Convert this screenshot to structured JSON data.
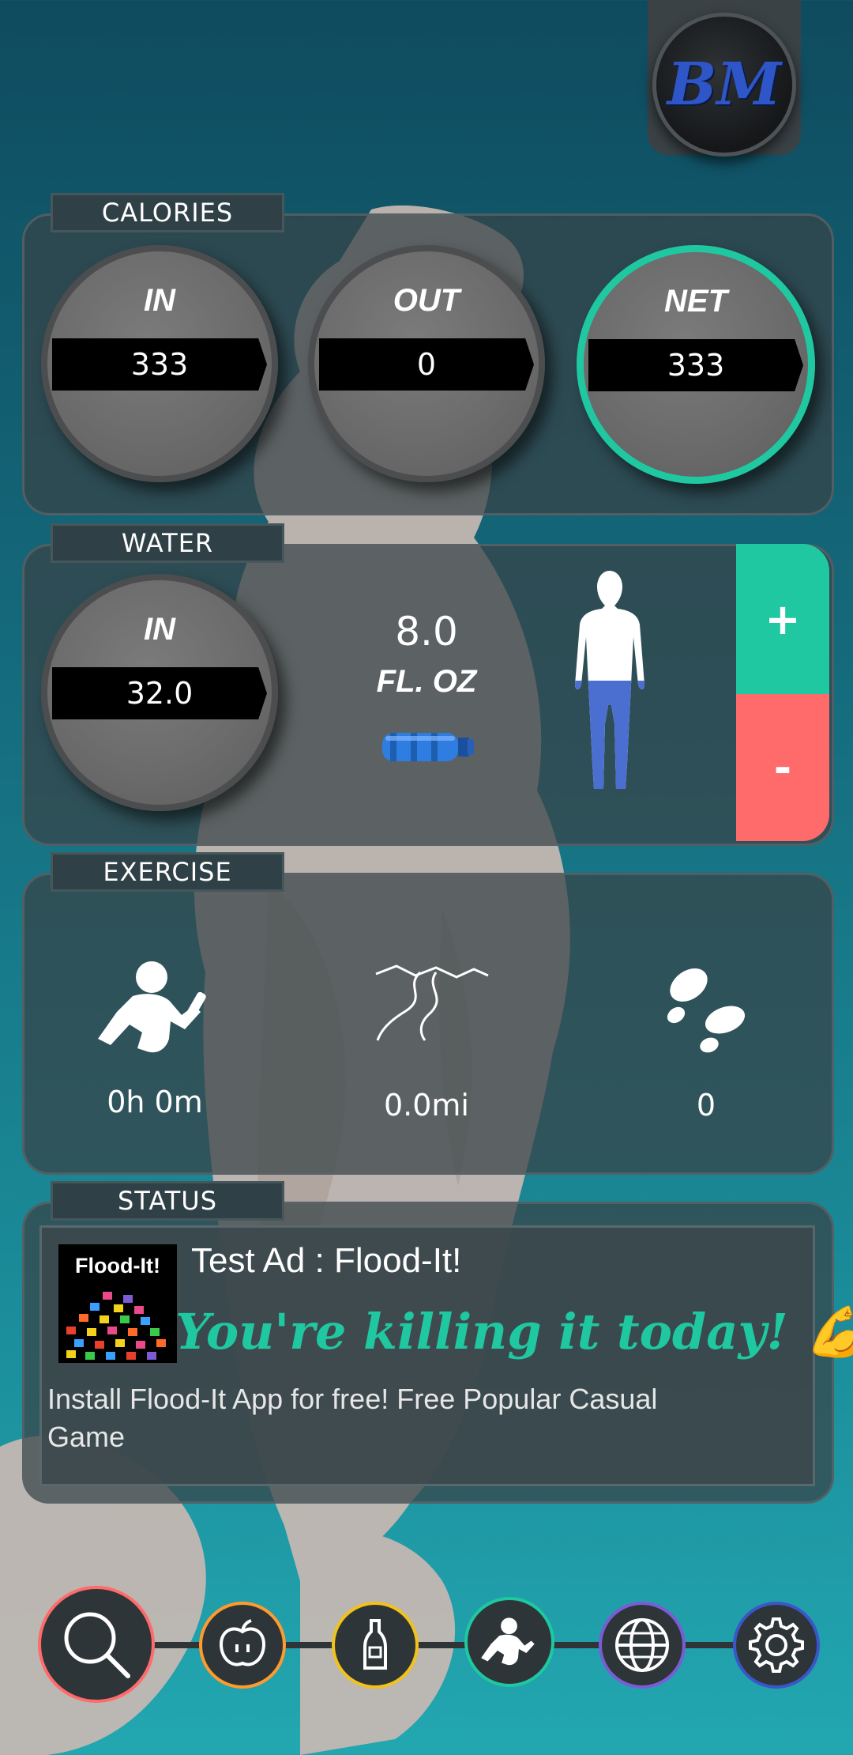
{
  "app": {
    "logo_text": "BM"
  },
  "calories": {
    "label": "CALORIES",
    "in": {
      "title": "IN",
      "value": "333"
    },
    "out": {
      "title": "OUT",
      "value": "0"
    },
    "net": {
      "title": "NET",
      "value": "333"
    }
  },
  "water": {
    "label": "WATER",
    "in": {
      "title": "IN",
      "value": "32.0"
    },
    "serving": {
      "value": "8.0",
      "unit": "FL. OZ"
    },
    "plus_label": "+",
    "minus_label": "-",
    "fill_fraction": 0.5
  },
  "exercise": {
    "label": "EXERCISE",
    "duration": "0h 0m",
    "distance": "0.0mi",
    "steps": "0"
  },
  "status": {
    "label": "STATUS",
    "ad_icon_text": "Flood-It!",
    "ad_title": "Test Ad : Flood-It!",
    "message": "You're killing it today! 💪",
    "ad_description": "Install Flood-It App for free! Free Popular Casual Game"
  },
  "nav": {
    "items": [
      "search-icon",
      "apple-icon",
      "bottle-icon",
      "workout-icon",
      "globe-icon",
      "gear-icon"
    ]
  },
  "colors": {
    "accent_green": "#1fc8a0",
    "minus_red": "#ff6b6b",
    "water_blue": "#4b6fd1"
  }
}
